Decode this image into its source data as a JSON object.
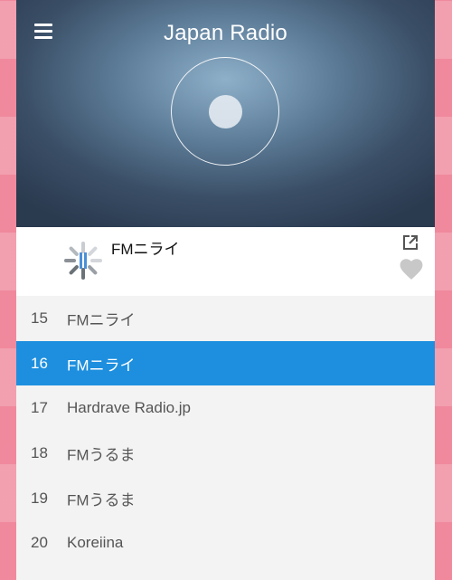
{
  "app": {
    "title": "Japan Radio",
    "menu_icon": "hamburger-menu-icon",
    "disc_icon": "radio-disc-icon",
    "accent_color": "#1e8fde"
  },
  "now_playing": {
    "station": "FMニライ",
    "status_icon": "loading-spinner-icon",
    "share_icon": "external-link-icon",
    "favorite_icon": "heart-icon"
  },
  "stations": [
    {
      "number": "15",
      "name": "FMニライ",
      "active": false
    },
    {
      "number": "16",
      "name": "FMニライ",
      "active": true
    },
    {
      "number": "17",
      "name": "Hardrave Radio.jp",
      "active": false
    },
    {
      "number": "18",
      "name": "FMうるま",
      "active": false
    },
    {
      "number": "19",
      "name": "FMうるま",
      "active": false
    },
    {
      "number": "20",
      "name": "Koreiina",
      "active": false
    }
  ]
}
